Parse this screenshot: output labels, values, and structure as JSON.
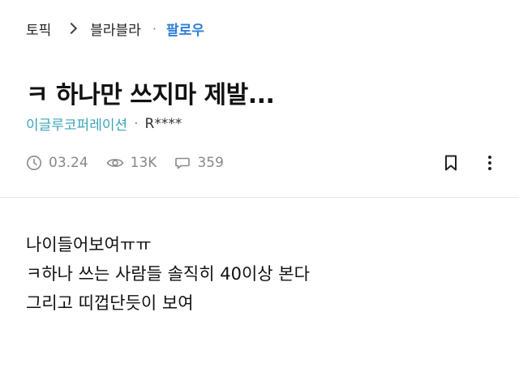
{
  "breadcrumb": {
    "topic": "토픽",
    "board": "블라블라",
    "separator": "·",
    "follow": "팔로우"
  },
  "post": {
    "title": "ㅋ 하나만 쓰지마 제발...",
    "company": "이글루코퍼레이션",
    "separator": "·",
    "author": "R****",
    "date": "03.24",
    "views": "13K",
    "comments": "359",
    "body": [
      "나이들어보여ㅠㅠ",
      "ㅋ하나 쓰는 사람들 솔직히 40이상 본다",
      "그리고 띠껍단듯이 보여"
    ]
  },
  "icons": {
    "chevron": "chevron-right-icon",
    "date": "clock-icon",
    "views": "eye-icon",
    "comments": "speech-bubble-icon",
    "bookmark": "bookmark-icon",
    "more": "more-vertical-icon"
  },
  "colors": {
    "follow": "#2f7fd6",
    "company": "#3aa5b8",
    "meta": "#888888"
  }
}
